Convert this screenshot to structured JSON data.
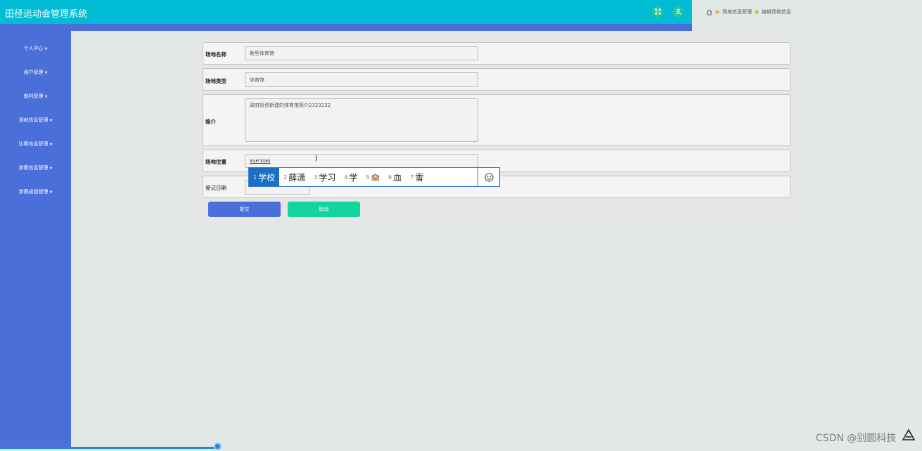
{
  "app": {
    "title": "田径运动会管理系统"
  },
  "header": {
    "fullscreen_icon": "expand-icon",
    "user_icon": "user-icon"
  },
  "breadcrumb": {
    "items": [
      "场地信息管理",
      "编辑场地信息"
    ]
  },
  "sidebar": {
    "items": [
      {
        "label": "个人中心"
      },
      {
        "label": "用户管理"
      },
      {
        "label": "裁判管理"
      },
      {
        "label": "场地信息管理"
      },
      {
        "label": "比赛信息管理"
      },
      {
        "label": "参赛信息管理"
      },
      {
        "label": "参赛成绩管理"
      }
    ]
  },
  "form": {
    "venue_name": {
      "label": "场地名称",
      "value": "新型体育馆"
    },
    "venue_type": {
      "label": "场地类型",
      "value": "体育馆"
    },
    "intro": {
      "label": "简介",
      "value": "政府投资新建的体育馆简介2323232"
    },
    "location": {
      "label": "场地位置",
      "value": "xue'xiao"
    },
    "reg_date": {
      "label": "登记日期",
      "value": ""
    },
    "submit_label": "提交",
    "cancel_label": "取消"
  },
  "ime": {
    "candidates": [
      {
        "num": "1",
        "text": "学校"
      },
      {
        "num": "2",
        "text": "薛潇"
      },
      {
        "num": "3",
        "text": "学习"
      },
      {
        "num": "4",
        "text": "学"
      },
      {
        "num": "5",
        "text": "🏫"
      },
      {
        "num": "6",
        "text": "血"
      },
      {
        "num": "7",
        "text": "雪"
      }
    ],
    "emoji_icon": "smiley-icon"
  },
  "watermark": "CSDN @别圆科技",
  "colors": {
    "header": "#00bcd4",
    "sidebar": "#4b6fd8",
    "submit": "#4b6fd8",
    "cancel": "#14d5a0",
    "ime_selected": "#1a6fc8"
  }
}
